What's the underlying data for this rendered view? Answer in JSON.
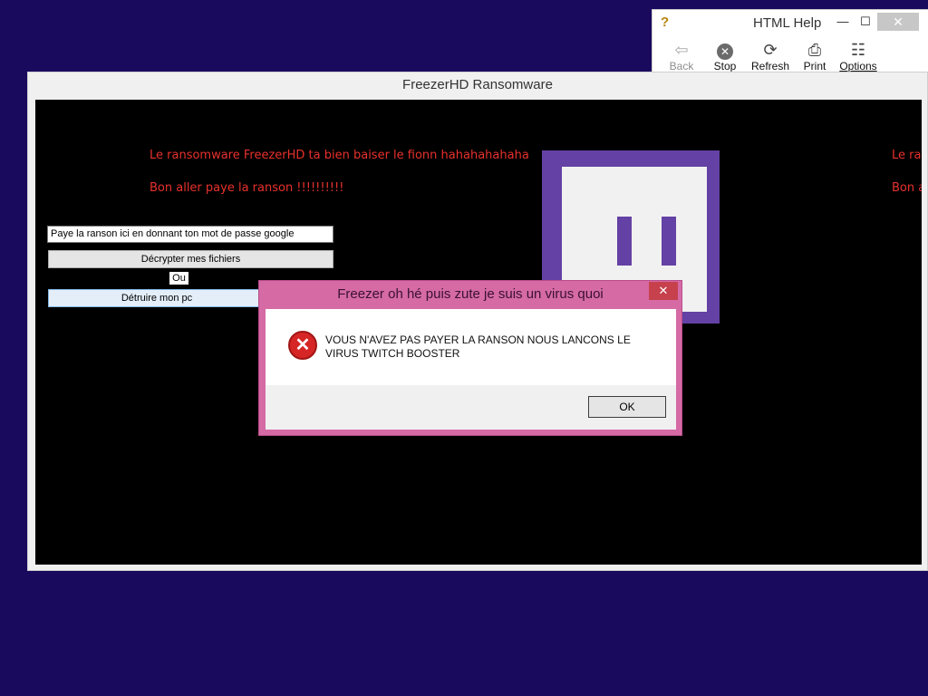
{
  "help_window": {
    "title": "HTML Help",
    "min_glyph": "—",
    "max_glyph": "☐",
    "close_glyph": "✕",
    "toolbar": [
      {
        "label": "Back",
        "icon": "back-arrow-icon",
        "glyph": "⇦"
      },
      {
        "label": "Stop",
        "icon": "stop-icon",
        "glyph": "✕"
      },
      {
        "label": "Refresh",
        "icon": "refresh-icon",
        "glyph": "⟳"
      },
      {
        "label": "Print",
        "icon": "printer-icon",
        "glyph": "⎙"
      },
      {
        "label": "Options",
        "icon": "options-icon",
        "glyph": "☷"
      }
    ]
  },
  "ransom_window": {
    "title": "FreezerHD Ransomware",
    "line1": "Le ransomware FreezerHD ta bien baiser le fionn hahahahahaha",
    "line2": "Bon aller paye la ranson !!!!!!!!!!",
    "line1_dup": "Le ran",
    "line2_dup": "Bon a",
    "password_input_value": "Paye la ranson ici en donnant ton mot de passe google",
    "decrypt_button": "Décrypter mes fichiers",
    "or_label": "Ou",
    "destroy_button": "Détruire mon pc"
  },
  "message_box": {
    "title": "Freezer oh hé puis zute je suis un virus quoi",
    "close_glyph": "✕",
    "message": "VOUS N'AVEZ PAS PAYER LA RANSON NOUS LANCONS LE VIRUS TWITCH BOOSTER",
    "ok_button": "OK",
    "error_glyph": "✕"
  },
  "colors": {
    "desktop": "#1a0a5e",
    "ransom_text": "#e8312c",
    "dialog_frame": "#d56aa5",
    "logo_purple": "#6441a4"
  }
}
